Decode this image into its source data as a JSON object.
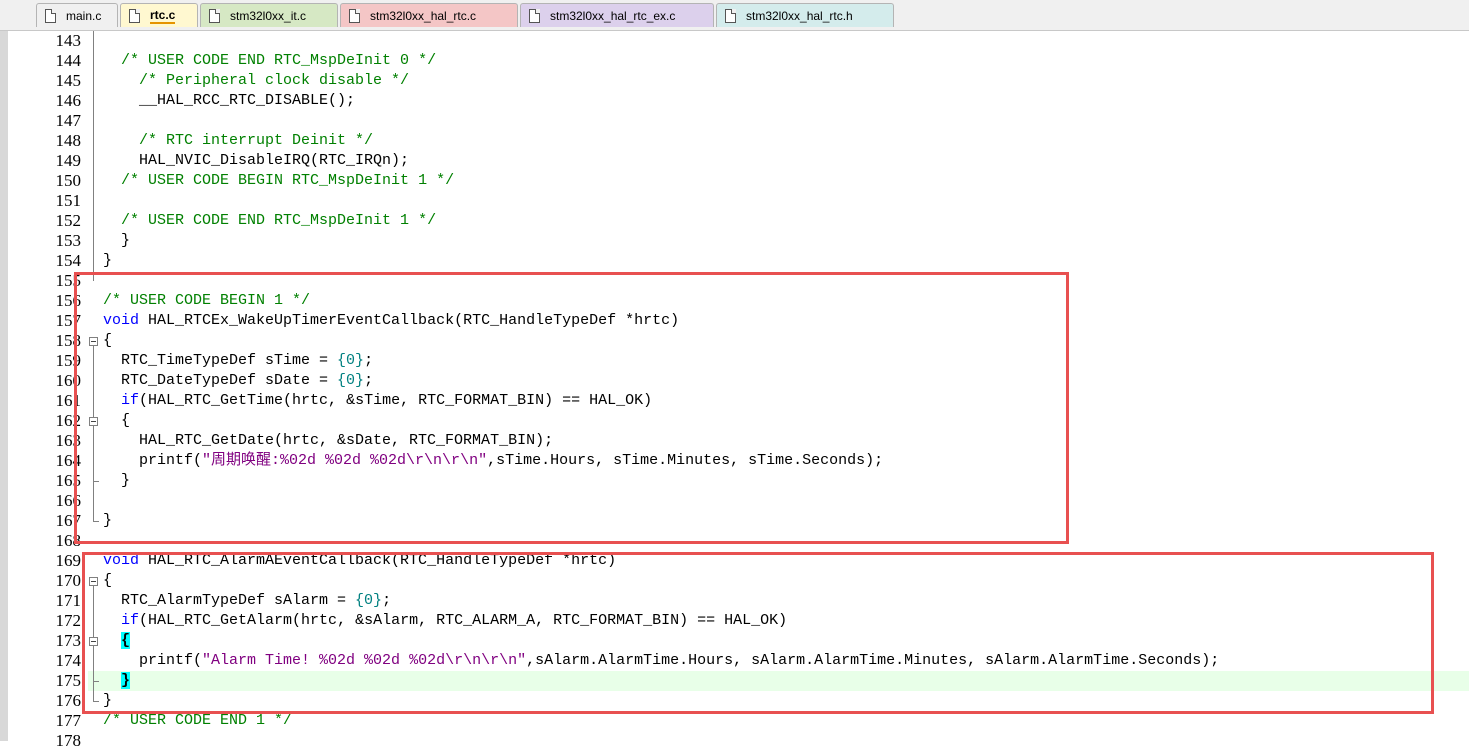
{
  "tabs": [
    {
      "label": "main.c",
      "active": false,
      "color": "#f0f0f0"
    },
    {
      "label": "rtc.c",
      "active": true,
      "color": "#fff8d0"
    },
    {
      "label": "stm32l0xx_it.c",
      "active": false,
      "color": "#d6e8c4"
    },
    {
      "label": "stm32l0xx_hal_rtc.c",
      "active": false,
      "color": "#f4c6c6"
    },
    {
      "label": "stm32l0xx_hal_rtc_ex.c",
      "active": false,
      "color": "#dcd0ec"
    },
    {
      "label": "stm32l0xx_hal_rtc.h",
      "active": false,
      "color": "#d4ecec"
    }
  ],
  "editor": {
    "line_numbers": [
      "143",
      "144",
      "145",
      "146",
      "147",
      "148",
      "149",
      "150",
      "151",
      "152",
      "153",
      "154",
      "155",
      "156",
      "157",
      "158",
      "159",
      "160",
      "161",
      "162",
      "163",
      "164",
      "165",
      "166",
      "167",
      "168",
      "169",
      "170",
      "171",
      "172",
      "173",
      "174",
      "175",
      "176",
      "177",
      "178"
    ],
    "lines": [
      "",
      "  /* USER CODE END RTC_MspDeInit 0 */",
      "    /* Peripheral clock disable */",
      "    __HAL_RCC_RTC_DISABLE();",
      "",
      "    /* RTC interrupt Deinit */",
      "    HAL_NVIC_DisableIRQ(RTC_IRQn);",
      "  /* USER CODE BEGIN RTC_MspDeInit 1 */",
      "",
      "  /* USER CODE END RTC_MspDeInit 1 */",
      "  }",
      "}",
      "",
      "/* USER CODE BEGIN 1 */",
      "void HAL_RTCEx_WakeUpTimerEventCallback(RTC_HandleTypeDef *hrtc)",
      "{",
      "  RTC_TimeTypeDef sTime = {0};",
      "  RTC_DateTypeDef sDate = {0};",
      "  if(HAL_RTC_GetTime(hrtc, &sTime, RTC_FORMAT_BIN) == HAL_OK)",
      "  {",
      "    HAL_RTC_GetDate(hrtc, &sDate, RTC_FORMAT_BIN);",
      "    printf(\"周期唤醒:%02d %02d %02d\\r\\n\\r\\n\",sTime.Hours, sTime.Minutes, sTime.Seconds);",
      "  }",
      "",
      "}",
      "",
      "void HAL_RTC_AlarmAEventCallback(RTC_HandleTypeDef *hrtc)",
      "{",
      "  RTC_AlarmTypeDef sAlarm = {0};",
      "  if(HAL_RTC_GetAlarm(hrtc, &sAlarm, RTC_ALARM_A, RTC_FORMAT_BIN) == HAL_OK)",
      "  {",
      "    printf(\"Alarm Time! %02d %02d %02d\\r\\n\\r\\n\",sAlarm.AlarmTime.Hours, sAlarm.AlarmTime.Minutes, sAlarm.AlarmTime.Seconds);",
      "  }",
      "}",
      "/* USER CODE END 1 */",
      ""
    ]
  },
  "colors": {
    "comment": "#008000",
    "keyword": "#0000ff",
    "string": "#800080",
    "number": "#008080",
    "annotation_box": "#e85050",
    "current_line": "#e8ffe8"
  }
}
